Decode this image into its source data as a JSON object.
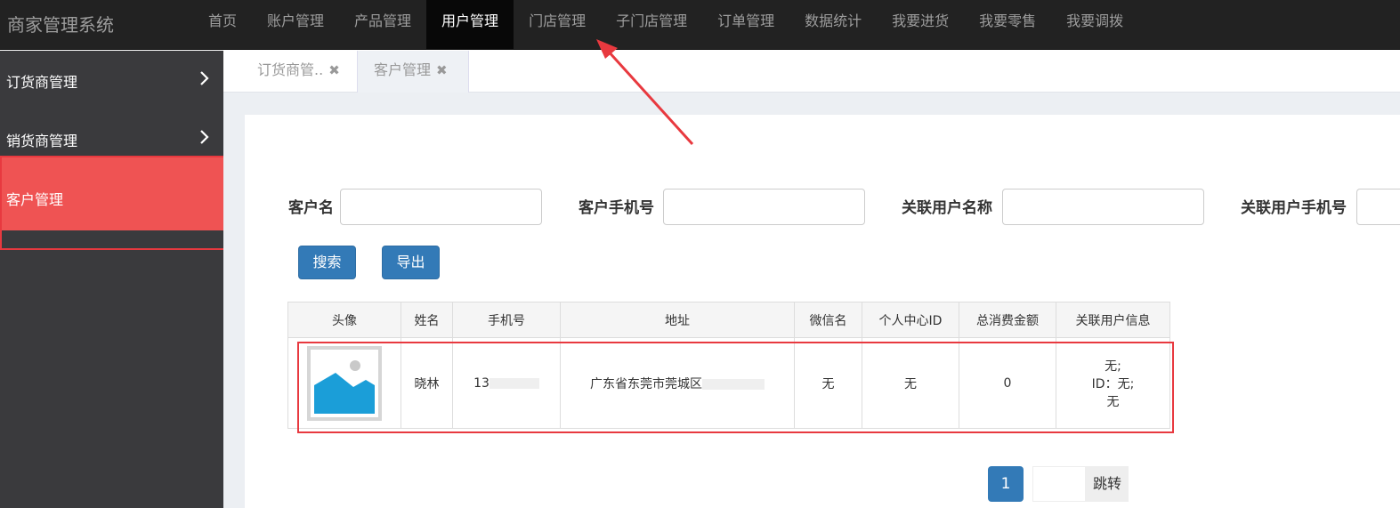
{
  "app": {
    "title": "商家管理系统"
  },
  "nav": {
    "items": [
      "首页",
      "账户管理",
      "产品管理",
      "用户管理",
      "门店管理",
      "子门店管理",
      "订单管理",
      "数据统计",
      "我要进货",
      "我要零售",
      "我要调拨"
    ],
    "active": "用户管理"
  },
  "sidebar": {
    "items": [
      {
        "label": "订货商管理"
      },
      {
        "label": "销货商管理"
      },
      {
        "label": "客户管理"
      }
    ]
  },
  "tabs": [
    {
      "label": "订货商管..",
      "close": "✖"
    },
    {
      "label": "客户管理",
      "close": "✖"
    }
  ],
  "search": {
    "customer_name_label": "客户名",
    "customer_phone_label": "客户手机号",
    "linked_user_name_label": "关联用户名称",
    "linked_user_phone_label": "关联用户手机号",
    "search_button": "搜索",
    "export_button": "导出"
  },
  "table": {
    "headers": [
      "头像",
      "姓名",
      "手机号",
      "地址",
      "微信名",
      "个人中心ID",
      "总消费金额",
      "关联用户信息"
    ],
    "row": {
      "name": "晓林",
      "phone": "13",
      "address": "广东省东莞市莞城区",
      "wechat": "无",
      "center_id": "无",
      "total": "0",
      "linked_line1": "无;",
      "linked_line2": "ID：无;",
      "linked_line3": "无"
    }
  },
  "pagination": {
    "current": "1",
    "jump_label": "跳转"
  },
  "colors": {
    "accent": "#337ab7",
    "sidebar_active": "#ef5353",
    "annotation": "#e8393f"
  }
}
